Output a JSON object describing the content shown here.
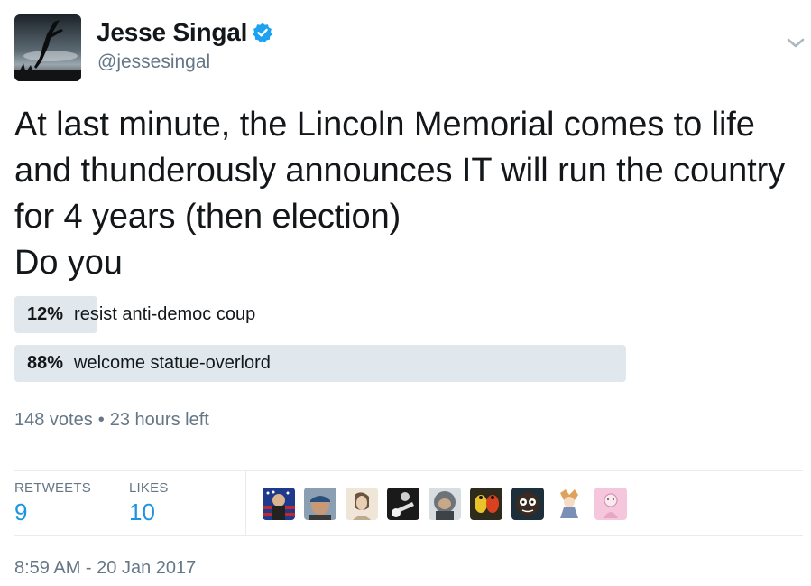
{
  "author": {
    "name": "Jesse Singal",
    "handle": "@jessesingal",
    "verified": true,
    "avatar_icon": "silhouette-leaping-figure-avatar"
  },
  "tweet": {
    "text": "At last minute, the Lincoln Memorial comes to life and thunderously announces IT will run the country for 4 years (then election)\nDo you"
  },
  "poll": {
    "choices": [
      {
        "percent_label": "12%",
        "label": "resist anti-democ coup",
        "fraction": 0.12
      },
      {
        "percent_label": "88%",
        "label": "welcome statue-overlord",
        "fraction": 0.88
      }
    ],
    "votes": "148 votes",
    "separator": "•",
    "time_left": "23 hours left"
  },
  "stats": {
    "retweets_label": "RETWEETS",
    "retweets": "9",
    "likes_label": "LIKES",
    "likes": "10"
  },
  "likers": [
    "flag-avatar",
    "cap-man-avatar",
    "sketch-portrait-avatar",
    "guitarist-avatar",
    "winter-hood-avatar",
    "parrots-avatar",
    "cartoon-character-avatar",
    "anime-character-avatar",
    "pink-sketch-avatar"
  ],
  "timestamp": "8:59 AM - 20 Jan 2017",
  "colors": {
    "text": "#14171a",
    "secondary": "#657786",
    "accent": "#1b95e0",
    "poll_bar": "#e1e8ed",
    "divider": "#e6ecf0"
  }
}
